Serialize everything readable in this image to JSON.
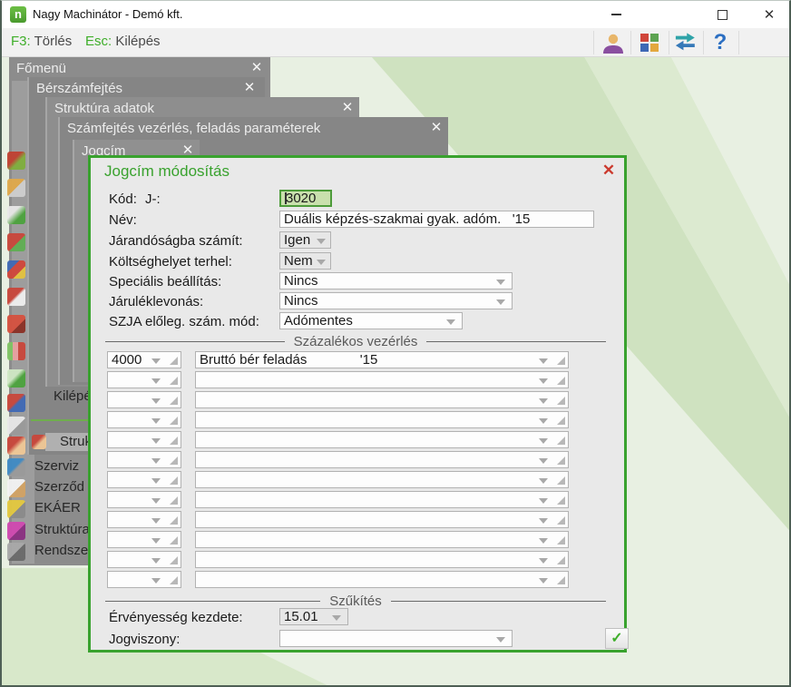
{
  "window": {
    "title": "Nagy Machinátor - Demó kft.",
    "app_icon_letter": "n"
  },
  "toolbar": {
    "shortcuts": [
      {
        "key": "F3:",
        "label": "Törlés"
      },
      {
        "key": "Esc:",
        "label": "Kilépés"
      }
    ],
    "icons": [
      "user-icon",
      "apps-icon",
      "swap-arrows-icon",
      "help-icon"
    ]
  },
  "windows": [
    {
      "title": "Főmenü"
    },
    {
      "title": "Bérszámfejtés"
    },
    {
      "title": "Struktúra adatok"
    },
    {
      "title": "Számfejtés vezérlés, feladás paraméterek"
    },
    {
      "title": "Jogcím"
    }
  ],
  "menus": {
    "kilepes": "Kilépé",
    "selected": "Strukt",
    "items": [
      "Szerviz",
      "Szerződ",
      "EKÁER",
      "Struktúra",
      "Rendsze"
    ]
  },
  "sidebar": {
    "icons": [
      "basket-icon",
      "cart-icon",
      "plant-icon",
      "pie-chart-icon",
      "cube-icon",
      "clipboard-icon",
      "book-icon",
      "bar-chart-icon",
      "money-icon",
      "house-icon",
      "mail-icon",
      "person-icon",
      "tools-icon",
      "contract-icon",
      "truck-icon",
      "prism-icon",
      "gears-icon"
    ]
  },
  "dialog": {
    "title": "Jogcím módosítás",
    "fields": {
      "kod_label": "Kód:",
      "kod_prefix": "J-:",
      "kod_value": "3020",
      "nev_label": "Név:",
      "nev_value": "Duális képzés-szakmai gyak. adóm.   '15",
      "jarandosag_label": "Járandóságba számít:",
      "jarandosag_value": "Igen",
      "koltseghely_label": "Költséghelyet terhel:",
      "koltseghely_value": "Nem",
      "specialis_label": "Speciális beállítás:",
      "specialis_value": "Nincs",
      "jarulek_label": "Járuléklevonás:",
      "jarulek_value": "Nincs",
      "szja_label": "SZJA előleg. szám. mód:",
      "szja_value": "Adómentes",
      "ervenyesseg_label": "Érvényesség kezdete:",
      "ervenyesseg_value": "15.01",
      "jogviszony_label": "Jogviszony:",
      "jogviszony_value": ""
    },
    "sections": {
      "percent": "Százalékos vezérlés",
      "filter": "Szűkítés"
    },
    "percent_first_row": {
      "code": "4000",
      "name": "Bruttó bér feladás              '15"
    }
  },
  "colors": {
    "accent_green": "#3fae2a",
    "dialog_border": "#39a22e",
    "close_red": "#cb3a2e",
    "selection_bg": "#c9e0ad",
    "background_light": "#e8f0e2",
    "background_dark": "#cfe2c0",
    "window_gray": "#8a8a8a"
  }
}
